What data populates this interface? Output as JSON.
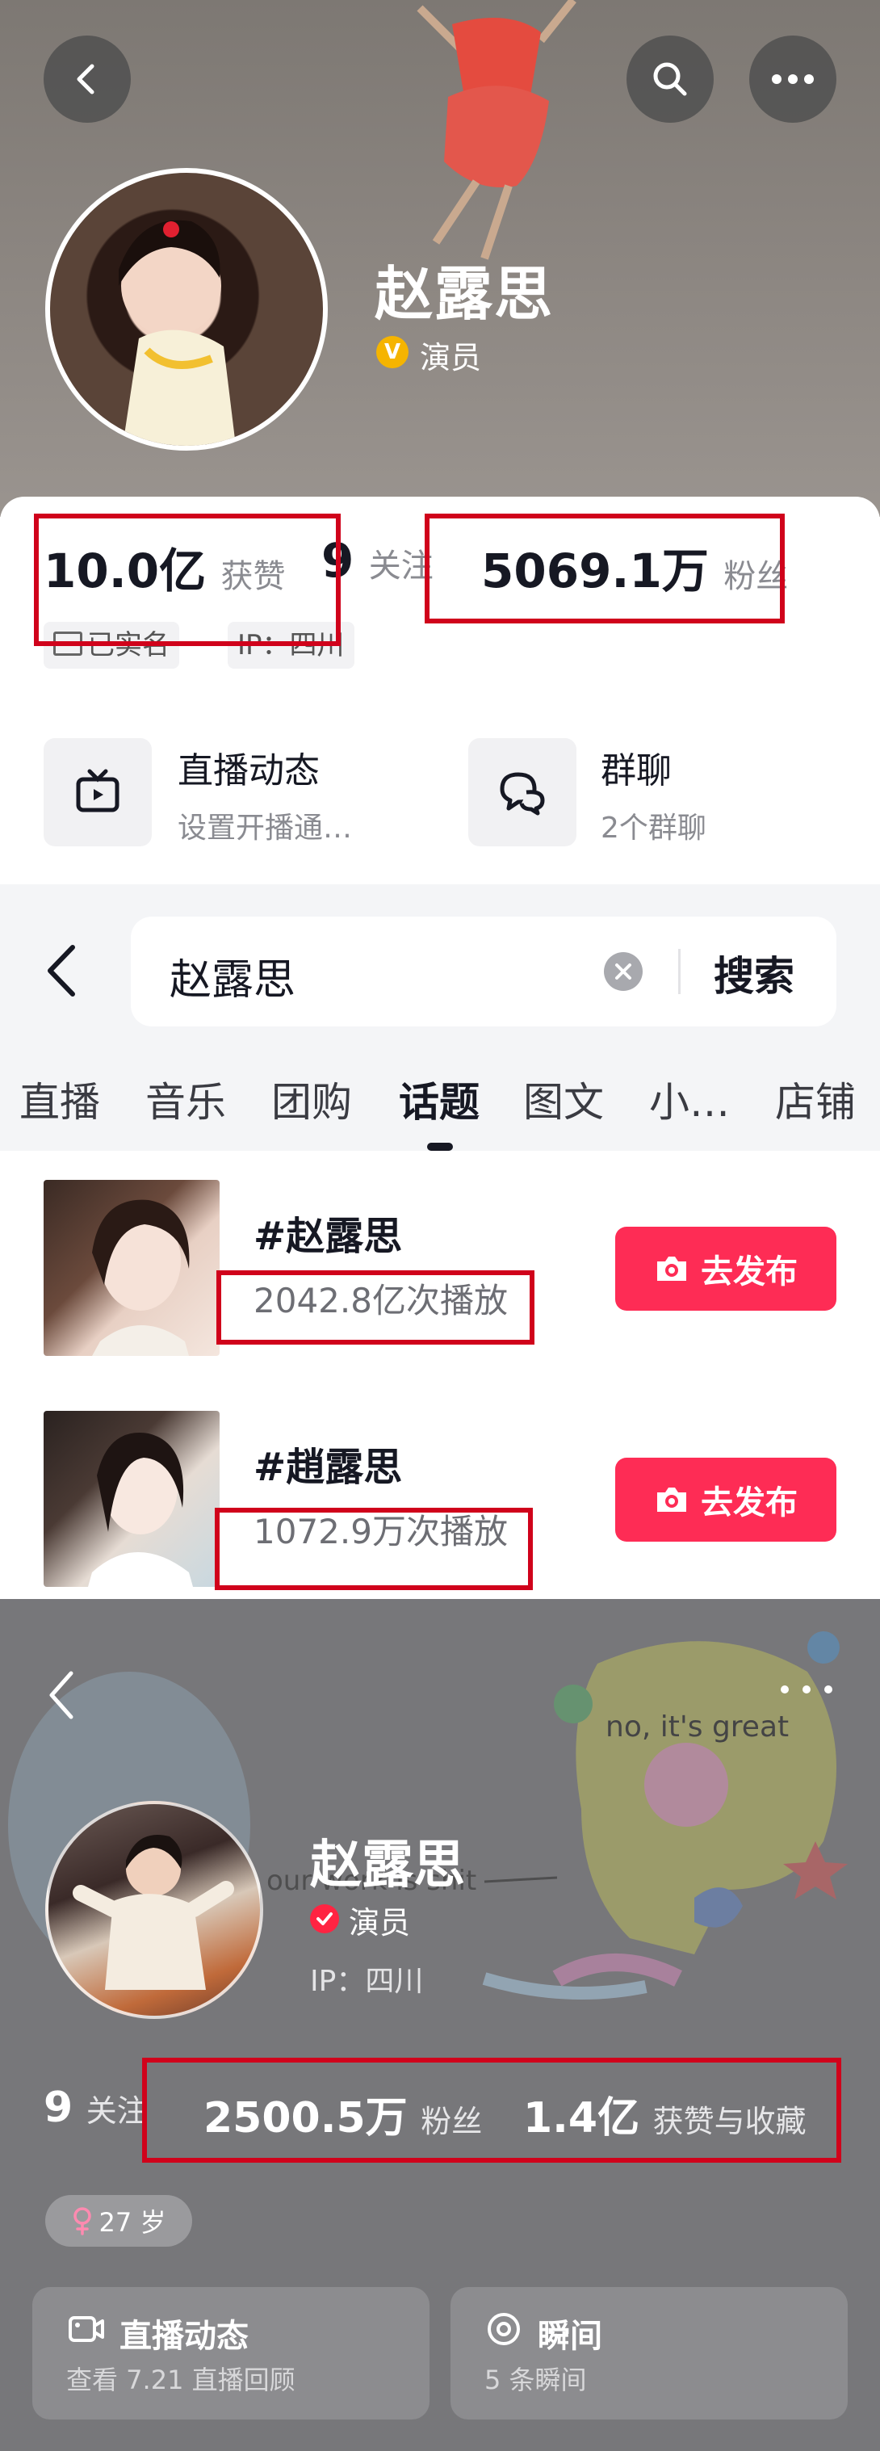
{
  "douyin_profile": {
    "name": "赵露思",
    "verified_role": "演员",
    "verified_badge": "V",
    "stats": {
      "likes_value": "10.0亿",
      "likes_label": "获赞",
      "following_value": "9",
      "following_label": "关注",
      "fans_value": "5069.1万",
      "fans_label": "粉丝"
    },
    "tags": [
      "已实名",
      "IP：四川"
    ],
    "features": [
      {
        "title": "直播动态",
        "subtitle": "设置开播通…",
        "icon": "tv-icon"
      },
      {
        "title": "群聊",
        "subtitle": "2个群聊",
        "icon": "chat-bubbles-icon"
      }
    ]
  },
  "search_page": {
    "query": "赵露思",
    "search_button": "搜索",
    "tabs": [
      "直播",
      "音乐",
      "团购",
      "话题",
      "图文",
      "小…",
      "店铺"
    ],
    "active_tab": "话题",
    "topics": [
      {
        "title": "#赵露思",
        "plays": "2042.8亿次播放",
        "button": "去发布"
      },
      {
        "title": "#趙露思",
        "plays": "1072.9万次播放",
        "button": "去发布"
      }
    ]
  },
  "xhs_profile": {
    "name": "赵露思",
    "verified_role": "演员",
    "ip": "IP：四川",
    "art_text_1": "no, it's great",
    "art_text_2": "our work is shit",
    "stats": {
      "following_value": "9",
      "following_label": "关注",
      "fans_value": "2500.5万",
      "fans_label": "粉丝",
      "likes_value": "1.4亿",
      "likes_label": "获赞与收藏"
    },
    "age_tag": "27 岁",
    "cards": [
      {
        "title": "直播动态",
        "subtitle": "查看 7.21 直播回顾",
        "icon": "video-camera-icon"
      },
      {
        "title": "瞬间",
        "subtitle": "5 条瞬间",
        "icon": "moment-ring-icon"
      }
    ]
  },
  "colors": {
    "highlight_box": "#d0021b",
    "douyin_red": "#fe2c55",
    "xhs_red": "#ff2442",
    "verified_gold": "#f5b400"
  }
}
